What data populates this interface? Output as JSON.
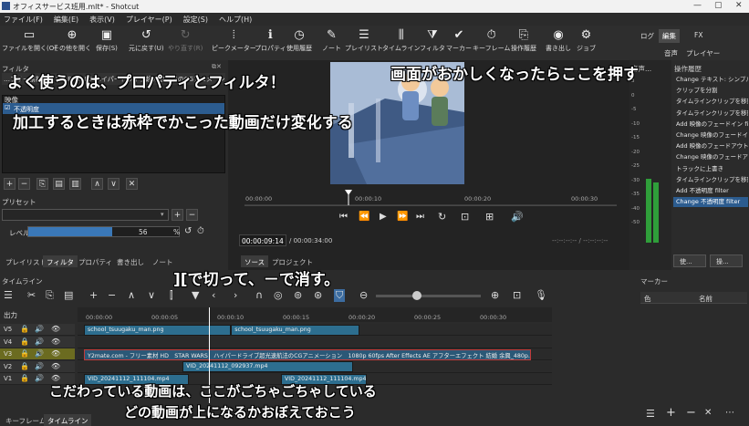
{
  "window": {
    "title": "オフィスサービス班用.mlt* - Shotcut",
    "controls": {
      "min": "—",
      "max": "▢",
      "close": "✕"
    }
  },
  "menu": {
    "items": [
      "ファイル(F)",
      "編集(E)",
      "表示(V)",
      "プレイヤー(P)",
      "設定(S)",
      "ヘルプ(H)"
    ]
  },
  "toolbar": {
    "open_file": "ファイルを開く(O)",
    "open_other": "その他を開く",
    "save": "保存(S)",
    "undo": "元に戻す(U)",
    "redo": "やり直す(R)",
    "peak_meter": "ピークメーター",
    "properties": "プロパティ",
    "recent": "使用履歴",
    "notes": "ノート",
    "playlist": "プレイリスト",
    "timeline": "タイムライン",
    "filters": "フィルタ",
    "markers": "マーカー",
    "keyframes": "キーフレーム",
    "history": "操作履歴",
    "export": "書き出し",
    "jobs": "ジョブ"
  },
  "layout_tabs": {
    "log": "ログ",
    "edit": "編集",
    "fx": "FX",
    "audio": "音声",
    "player": "プレイヤー"
  },
  "filter_panel": {
    "title": "フィルタ",
    "clip_name": "…フリー素材 HD STAR WARS ハイパードライブ超光速航法のCGアニメーション 1080p 60fps After Effects AE アフターエフェクト 結婚 余興_480p.mp4",
    "section_video": "映像",
    "filter_item": "不透明度",
    "preset_label": "プリセット",
    "level_label": "レベル",
    "level_value": "56",
    "level_unit": "%",
    "level_fraction": 0.56
  },
  "bottom_tabs": [
    "プレイリスト",
    "フィルタ",
    "プロパティ",
    "書き出し",
    "ノート"
  ],
  "viewer": {
    "ruler_ticks": [
      "00:00:00",
      "00:00:10",
      "00:00:20",
      "00:00:30"
    ],
    "timecode": "00:00:09:14",
    "duration": "/ 00:00:34:00",
    "in_out": "--:--:--:-- / --:--:--:--",
    "tabs": [
      "ソース",
      "プロジェクト"
    ]
  },
  "audio_panel": {
    "title": "音声...",
    "scale": [
      "3",
      "0",
      "-5",
      "-10",
      "-15",
      "-20",
      "-25",
      "-30",
      "-35",
      "-40",
      "-50"
    ]
  },
  "history_panel": {
    "title": "操作履歴",
    "items": [
      "Change テキスト: シンプル filter",
      "クリップを分割",
      "タイムラインクリップを移動",
      "タイムラインクリップを移動",
      "Add 映像のフェードイン filter",
      "Change 映像のフェードイン filter",
      "Add 映像のフェードアウト filter",
      "Change 映像のフェードアウト filter",
      "トラックに上書き",
      "タイムラインクリップを移動",
      "Add 不透明度 filter",
      "Change 不透明度 filter"
    ],
    "selected_index": 11,
    "buttons": [
      "使...",
      "操..."
    ]
  },
  "timeline": {
    "title": "タイムライン",
    "output_label": "出力",
    "ruler_ticks": [
      "00:00:00",
      "00:00:05",
      "00:00:10",
      "00:00:15",
      "00:00:20",
      "00:00:25",
      "00:00:30"
    ],
    "tracks": [
      {
        "name": "V5",
        "clips": [
          {
            "label": "school_tsuugaku_man.png",
            "start": 0,
            "end": 11.2
          },
          {
            "label": "school_tsuugaku_man.png",
            "start": 11.2,
            "end": 21
          }
        ]
      },
      {
        "name": "V4",
        "clips": []
      },
      {
        "name": "V3",
        "clips": [
          {
            "label": "Y2mate.com - フリー素材 HD　STAR WARS　ハイパードライブ超光速航法のCGアニメーション　1080p 60fps After Effects AE アフターエフェクト 結婚 余興_480p.mp4",
            "start": 0,
            "end": 34
          }
        ]
      },
      {
        "name": "V2",
        "clips": [
          {
            "label": "VID_20241112_092937.mp4",
            "start": 7.5,
            "end": 20.5
          }
        ]
      },
      {
        "name": "V1",
        "clips": [
          {
            "label": "VID_20241112_111104.mp4",
            "start": 0,
            "end": 8
          },
          {
            "label": "VID_20241112_111104.mp4",
            "start": 15,
            "end": 21.5
          }
        ]
      }
    ],
    "tabs": [
      "キーフレーム",
      "タイムライン"
    ]
  },
  "markers_panel": {
    "title": "マーカー",
    "col_color": "色",
    "col_name": "名前"
  },
  "captions": {
    "c1": "よく使うのは、プロパティとフィルタ！",
    "c2": "加工するときは赤枠でかこった動画だけ変化する",
    "c3": "画面がおかしくなったらここを押す",
    "c4": "][で切って、－で消す。",
    "c5": "こだわっている動画は、ここがごちゃごちゃしている",
    "c6": "どの動画が上になるかおぼえておこう"
  },
  "colors": {
    "accent": "#2c5c8f",
    "clip_blue": "#2d6e8f",
    "track_yellow": "#6b6b20",
    "playhead": "#ffffff"
  }
}
